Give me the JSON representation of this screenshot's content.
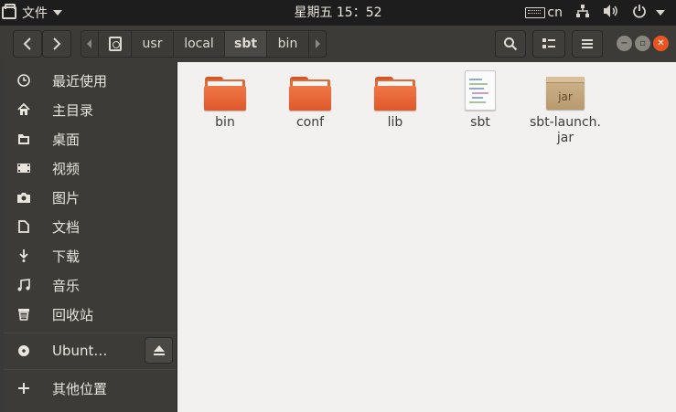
{
  "topbar": {
    "app_name": "文件",
    "clock": "星期五 15：52",
    "keyboard_layout": "cn"
  },
  "headerbar": {
    "breadcrumbs": [
      "usr",
      "local",
      "sbt",
      "bin"
    ],
    "active_crumb": "sbt"
  },
  "sidebar": {
    "items": [
      {
        "label": "最近使用",
        "icon": "clock-icon"
      },
      {
        "label": "主目录",
        "icon": "home-icon"
      },
      {
        "label": "桌面",
        "icon": "desktop-folder-icon"
      },
      {
        "label": "视频",
        "icon": "video-icon"
      },
      {
        "label": "图片",
        "icon": "camera-icon"
      },
      {
        "label": "文档",
        "icon": "document-icon"
      },
      {
        "label": "下载",
        "icon": "download-icon"
      },
      {
        "label": "音乐",
        "icon": "music-icon"
      },
      {
        "label": "回收站",
        "icon": "trash-icon"
      }
    ],
    "device": {
      "label": "Ubunt…",
      "icon": "disc-icon"
    },
    "other_locations": {
      "label": "其他位置",
      "icon": "plus-icon"
    }
  },
  "files": [
    {
      "name": "bin",
      "type": "folder"
    },
    {
      "name": "conf",
      "type": "folder"
    },
    {
      "name": "lib",
      "type": "folder"
    },
    {
      "name": "sbt",
      "type": "script"
    },
    {
      "name": "sbt-launch.\njar",
      "type": "jar",
      "badge": "jar"
    }
  ],
  "colors": {
    "accent": "#e95420",
    "sidebar": "#3c3b37",
    "content": "#f2f1f0"
  }
}
